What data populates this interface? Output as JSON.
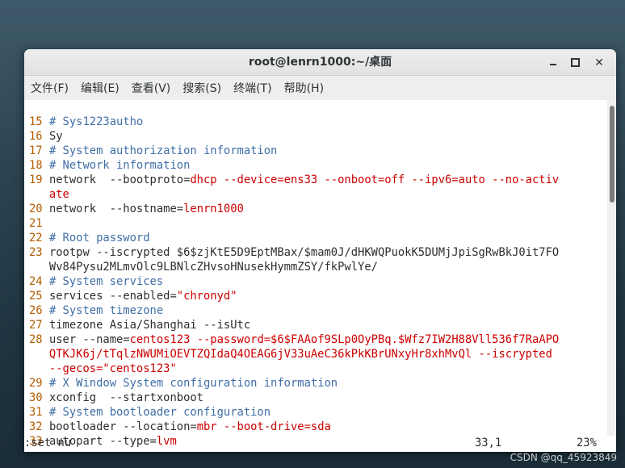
{
  "window": {
    "title": "root@lenrn1000:~/桌面"
  },
  "menu": [
    "文件(F)",
    "编辑(E)",
    "查看(V)",
    "搜索(S)",
    "终端(T)",
    "帮助(H)"
  ],
  "lines": [
    {
      "num": "15",
      "type": "comment",
      "text": "# Sys1223autho"
    },
    {
      "num": "16",
      "type": "plain",
      "text": "Sy"
    },
    {
      "num": "17",
      "type": "comment",
      "text": "# System authorization information"
    },
    {
      "num": "18",
      "type": "comment",
      "text": "# Network information"
    },
    {
      "num": "19",
      "type": "network"
    },
    {
      "num": "20",
      "type": "hostname"
    },
    {
      "num": "21",
      "type": "plain",
      "text": ""
    },
    {
      "num": "22",
      "type": "comment",
      "text": "# Root password"
    },
    {
      "num": "23",
      "type": "rootpw"
    },
    {
      "num": "24",
      "type": "comment",
      "text": "# System services"
    },
    {
      "num": "25",
      "type": "services"
    },
    {
      "num": "26",
      "type": "comment",
      "text": "# System timezone"
    },
    {
      "num": "27",
      "type": "plain",
      "text": "timezone Asia/Shanghai --isUtc"
    },
    {
      "num": "28",
      "type": "user"
    },
    {
      "num": "29",
      "type": "comment",
      "text": "# X Window System configuration information"
    },
    {
      "num": "30",
      "type": "plain",
      "text": "xconfig  --startxonboot"
    },
    {
      "num": "31",
      "type": "comment",
      "text": "# System bootloader configuration"
    },
    {
      "num": "32",
      "type": "bootloader"
    },
    {
      "num": "33",
      "type": "autopart"
    }
  ],
  "seg": {
    "network_1": "network  --bootproto=",
    "network_2": "dhcp --device=ens33 --onboot=off --ipv6=auto --no-activ",
    "network_3": "ate",
    "hostname_1": "network  --hostname=",
    "hostname_2": "lenrn1000",
    "rootpw_1": "rootpw --iscrypted $6$zjKtE5D9EptMBax/$mam0J/dHKWQPuokK5DUMjJpiSgRwBkJ0it7FO",
    "rootpw_2": "Wv84Pysu2MLmvOlc9LBNlcZHvsoHNusekHymmZSY/fkPwlYe/",
    "services_1": "services --enabled=",
    "services_2": "\"chronyd\"",
    "user_1": "user --name=",
    "user_2": "centos123 --password=$6$FAAof9SLp0OyPBq.$Wfz7IW2H88Vll536f7RaAPO",
    "user_3": "QTKJK6j/tTqlzNWUMiOEVTZQIdaQ4OEAG6jV33uAeC36kPkKBrUNxyHr8xhMvQl --iscrypted",
    "user_4": "--gecos=\"centos123\"",
    "bootloader_1": "bootloader --location=",
    "bootloader_2": "mbr --boot-drive=sda",
    "autopart_1": "autopart --type=",
    "autopart_2": "lvm"
  },
  "status": {
    "command": ":set nu",
    "position": "33,1",
    "percent": "23%"
  },
  "watermark": "CSDN @qq_45923849",
  "colors": {
    "line_number": "#b35c00",
    "comment": "#3f6ea6",
    "option_value": "#cc0000"
  }
}
